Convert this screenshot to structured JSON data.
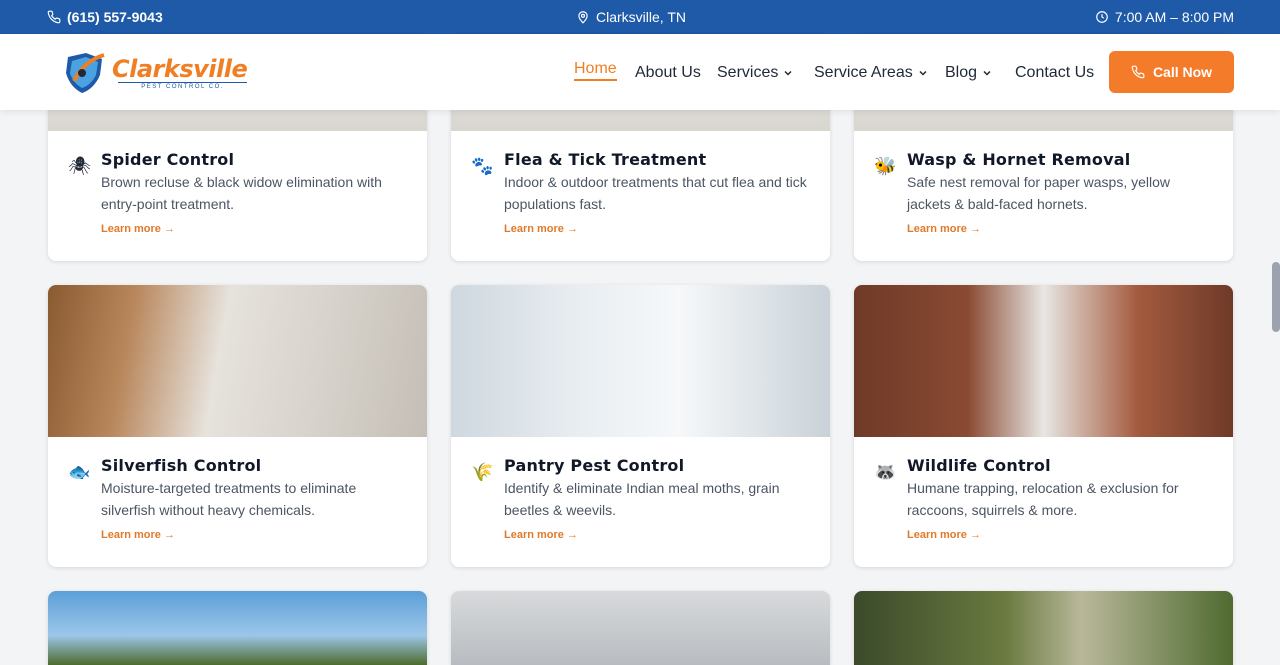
{
  "topbar": {
    "phone": "(615) 557-9043",
    "location": "Clarksville, TN",
    "hours": "7:00 AM – 8:00 PM",
    "bg_color": "#1e5aa8"
  },
  "logo": {
    "name": "Clarksville",
    "subtitle": "PEST CONTROL CO."
  },
  "nav": {
    "items": [
      {
        "label": "Home",
        "active": true
      },
      {
        "label": "About Us"
      },
      {
        "label": "Services",
        "dropdown": true
      },
      {
        "label": "Service Areas",
        "dropdown": true
      },
      {
        "label": "Blog",
        "dropdown": true
      },
      {
        "label": "Contact Us"
      }
    ],
    "cta_label": "Call Now",
    "accent_color": "#f47b2a"
  },
  "cards": [
    {
      "icon": "🕷",
      "icon_name": "spider-icon",
      "title": "Spider Control",
      "desc": "Brown recluse & black widow elimination with entry-point treatment.",
      "link": "Learn more →"
    },
    {
      "icon": "🐾",
      "icon_name": "paw-icon",
      "title": "Flea & Tick Treatment",
      "desc": "Indoor & outdoor treatments that cut flea and tick populations fast.",
      "link": "Learn more →"
    },
    {
      "icon": "🐝",
      "icon_name": "bee-icon",
      "title": "Wasp & Hornet Removal",
      "desc": "Safe nest removal for paper wasps, yellow jackets & bald-faced hornets.",
      "link": "Learn more →"
    },
    {
      "icon": "🐟",
      "icon_name": "fish-icon",
      "title": "Silverfish Control",
      "desc": "Moisture-targeted treatments to eliminate silverfish without heavy chemicals.",
      "link": "Learn more →"
    },
    {
      "icon": "🌾",
      "icon_name": "grain-icon",
      "title": "Pantry Pest Control",
      "desc": "Identify & eliminate Indian meal moths, grain beetles & weevils.",
      "link": "Learn more →"
    },
    {
      "icon": "🦝",
      "icon_name": "raccoon-icon",
      "title": "Wildlife Control",
      "desc": "Humane trapping, relocation & exclusion for raccoons, squirrels & more.",
      "link": "Learn more →"
    }
  ]
}
